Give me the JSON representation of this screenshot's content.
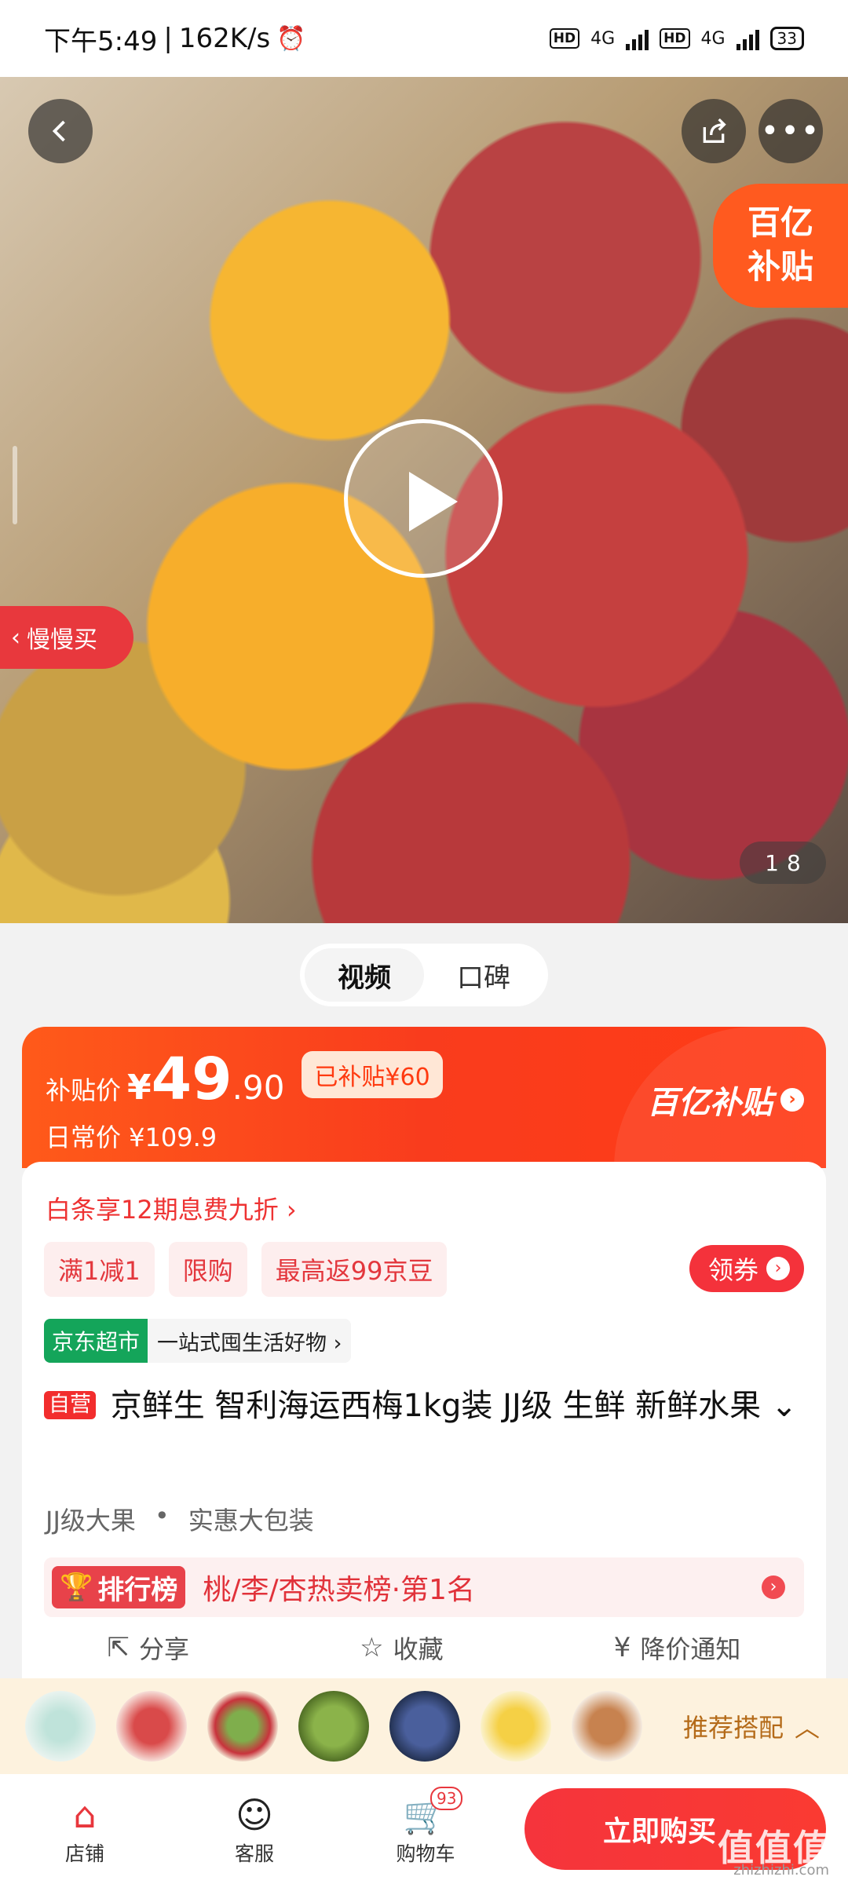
{
  "status_bar": {
    "time": "下午5:49",
    "speed": "162K/s",
    "alarm_icon": "alarm-icon",
    "hd1": "HD",
    "net1": "4G",
    "hd2": "HD",
    "net2": "4G",
    "battery": "33"
  },
  "hero": {
    "slow_buy": "慢慢买",
    "subsidy_line1": "百亿",
    "subsidy_line2": "补贴",
    "pager_current": "1",
    "pager_total": "8"
  },
  "media_tabs": [
    {
      "label": "视频",
      "active": true
    },
    {
      "label": "口碑",
      "active": false
    }
  ],
  "price": {
    "label": "补贴价",
    "currency": "¥",
    "integer": "49",
    "decimal": ".90",
    "saved": "已补贴¥60",
    "daily": "日常价 ¥109.9",
    "brand": "百亿补贴",
    "accent": "#ff4a18"
  },
  "promo": {
    "installment": "白条享12期息费九折 ›",
    "chips": [
      "满1减1",
      "限购",
      "最高返99京豆"
    ],
    "coupon": "领券"
  },
  "market": {
    "badge": "京东超市",
    "text": "一站式囤生活好物 ›"
  },
  "product": {
    "self_tag": "自营",
    "title": "京鲜生 智利海运西梅1kg装 JJ级 生鲜 新鲜水果 ⌄",
    "tags": [
      "JJ级大果",
      "•",
      "实惠大包装"
    ]
  },
  "rank": {
    "badge": "排行榜",
    "text": "桃/李/杏热卖榜·第1名"
  },
  "actions": [
    {
      "icon": "share-icon",
      "label": "分享"
    },
    {
      "icon": "star-icon",
      "label": "收藏"
    },
    {
      "icon": "price-alert-icon",
      "label": "降价通知"
    }
  ],
  "recommend": {
    "label": "推荐搭配",
    "thumbs": [
      "#9fcfc4",
      "#d94a4a",
      "#7fae4c",
      "#6b8f2d",
      "#34457a",
      "#f2c230",
      "#c7824f"
    ]
  },
  "bottom": {
    "shop": "店铺",
    "service": "客服",
    "cart": "购物车",
    "cart_count": "93",
    "buy": "立即购买",
    "watermark": "值值值",
    "watermark_url": "zhizhizhi.com"
  }
}
